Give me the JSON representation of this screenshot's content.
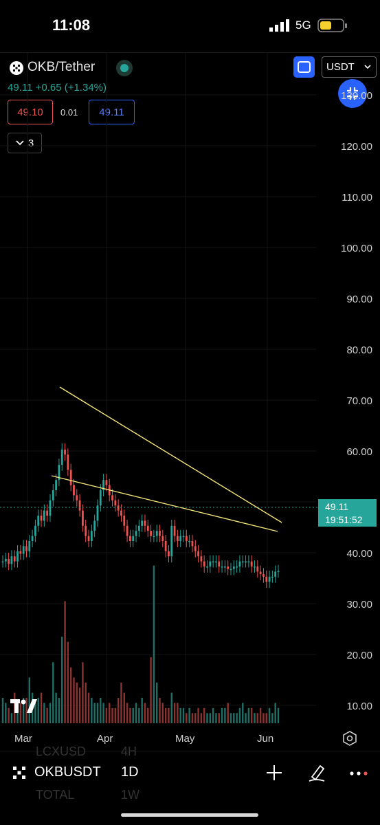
{
  "status": {
    "time": "11:08",
    "network": "5G"
  },
  "header": {
    "pair": "OKB/Tether",
    "price_line": "49.11 +0.65 (+1.34%)",
    "bid": "49.10",
    "spread": "0.01",
    "ask": "49.11",
    "collapse_count": "3",
    "currency": "USDT"
  },
  "colors": {
    "up": "#26a69a",
    "down": "#ef5350",
    "accent": "#2962ff",
    "trendline": "#f5e67a"
  },
  "chart_data": {
    "type": "candlestick",
    "symbol": "OKB/Tether",
    "y_ticks": [
      "130.00",
      "120.00",
      "110.00",
      "100.00",
      "90.00",
      "80.00",
      "70.00",
      "60.00",
      "50.00",
      "40.00",
      "30.00",
      "20.00",
      "10.00"
    ],
    "x_ticks": [
      "Mar",
      "Apr",
      "May",
      "Jun"
    ],
    "last_price": "49.11",
    "countdown": "19:51:52",
    "close_series": [
      51,
      51.5,
      50.5,
      52,
      51,
      53,
      52.5,
      54,
      53,
      55,
      56,
      58,
      60,
      59,
      61,
      60,
      63,
      65,
      67,
      70,
      73,
      72,
      69,
      66,
      64,
      63,
      61,
      58,
      56,
      55,
      57,
      59,
      62,
      65,
      67,
      66,
      64,
      63,
      62,
      61,
      60,
      58,
      56,
      55,
      56,
      57,
      58,
      59,
      58,
      57,
      56,
      56,
      57,
      56,
      55,
      53,
      52,
      58,
      56,
      55,
      56,
      56,
      55,
      55,
      54,
      53,
      52,
      51,
      50,
      50,
      51,
      51,
      51,
      50,
      50,
      50,
      49.5,
      49.5,
      50,
      50,
      51,
      51,
      51,
      51,
      50,
      50,
      49,
      48.5,
      48,
      47,
      48,
      48,
      49,
      49.11
    ],
    "volume_series": [
      5,
      4,
      3,
      2,
      6,
      3,
      4,
      5,
      5,
      9,
      6,
      4,
      5,
      6,
      4,
      3,
      4,
      12,
      6,
      5,
      17,
      24,
      16,
      11,
      9,
      8,
      7,
      12,
      8,
      6,
      5,
      4,
      4,
      5,
      4,
      3,
      4,
      3,
      3,
      5,
      8,
      6,
      4,
      3,
      3,
      4,
      3,
      5,
      4,
      3,
      13,
      31,
      8,
      5,
      4,
      3,
      3,
      6,
      4,
      4,
      3,
      3,
      2,
      3,
      2,
      2,
      3,
      2,
      3,
      2,
      2,
      3,
      2,
      2,
      3,
      3,
      4,
      2,
      2,
      2,
      3,
      4,
      2,
      3,
      3,
      2,
      2,
      3,
      2,
      2,
      3,
      2,
      4,
      3
    ]
  },
  "bottom": {
    "symbol": "OKBUSDT",
    "interval": "1D",
    "ghost_symbol": "LCXUSD",
    "ghost_interval": "4H",
    "ghost_total": "TOTAL",
    "ghost_total_interval": "1W"
  }
}
